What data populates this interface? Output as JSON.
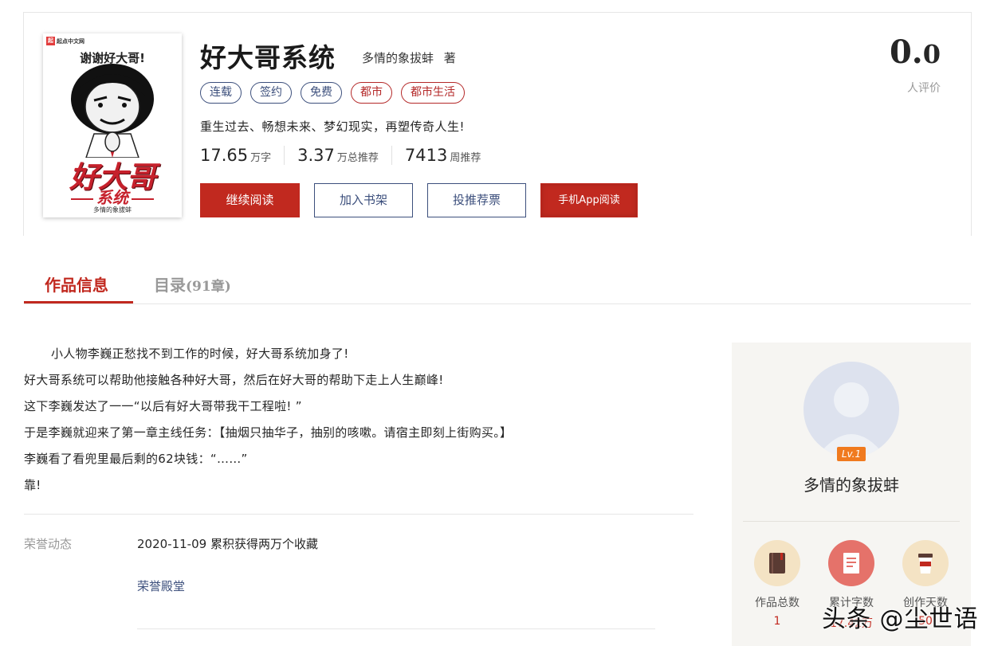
{
  "cover": {
    "logo_mark": "起",
    "logo_text": "起点中文网",
    "tagline": "谢谢好大哥!",
    "title_main": "好大哥",
    "title_sub": "系统",
    "author": "多情的象拔蚌"
  },
  "book": {
    "title": "好大哥系统",
    "author": "多情的象拔蚌",
    "author_suffix": "著",
    "tags": [
      "连载",
      "签约",
      "免费",
      "都市",
      "都市生活"
    ],
    "intro": "重生过去、畅想未来、梦幻现实，再塑传奇人生!",
    "stats": [
      {
        "num": "17.65",
        "unit": "万字"
      },
      {
        "num": "3.37",
        "unit": "万总推荐"
      },
      {
        "num": "7413",
        "unit": "周推荐"
      }
    ],
    "buttons": {
      "read": "继续阅读",
      "shelf": "加入书架",
      "vote": "投推荐票",
      "app": "手机App阅读"
    },
    "score_int": "0.",
    "score_dec": "0",
    "score_label": "人评价"
  },
  "tabs": {
    "info": "作品信息",
    "toc": "目录",
    "toc_count": "(91章)"
  },
  "description": [
    "小人物李巍正愁找不到工作的时候，好大哥系统加身了!",
    "好大哥系统可以帮助他接触各种好大哥，然后在好大哥的帮助下走上人生巅峰!",
    "这下李巍发达了一一“以后有好大哥带我干工程啦! ”",
    "于是李巍就迎来了第一章主线任务：【抽烟只抽华子，抽别的咳嗽。请宿主即刻上街购买。】",
    "李巍看了看兜里最后剩的62块钱：“……”",
    "靠!"
  ],
  "honor": {
    "label": "荣誉动态",
    "item": "2020-11-09  累积获得两万个收藏",
    "link": "荣誉殿堂"
  },
  "author_card": {
    "level": "Lv.1",
    "name": "多情的象拔蚌",
    "stats": [
      {
        "label": "作品总数",
        "value": "1",
        "icon": "book-icon",
        "bg": "#f4e3c4"
      },
      {
        "label": "累计字数",
        "value": "17.42万",
        "icon": "document-icon",
        "bg": "#e5726a"
      },
      {
        "label": "创作天数",
        "value": "50",
        "icon": "coffee-cup-icon",
        "bg": "#f4e3c4"
      }
    ]
  },
  "watermark": "头条 @尘世语",
  "colors": {
    "accent": "#c1291f",
    "tag_blue": "#3c4f7c",
    "muted": "#999999"
  }
}
